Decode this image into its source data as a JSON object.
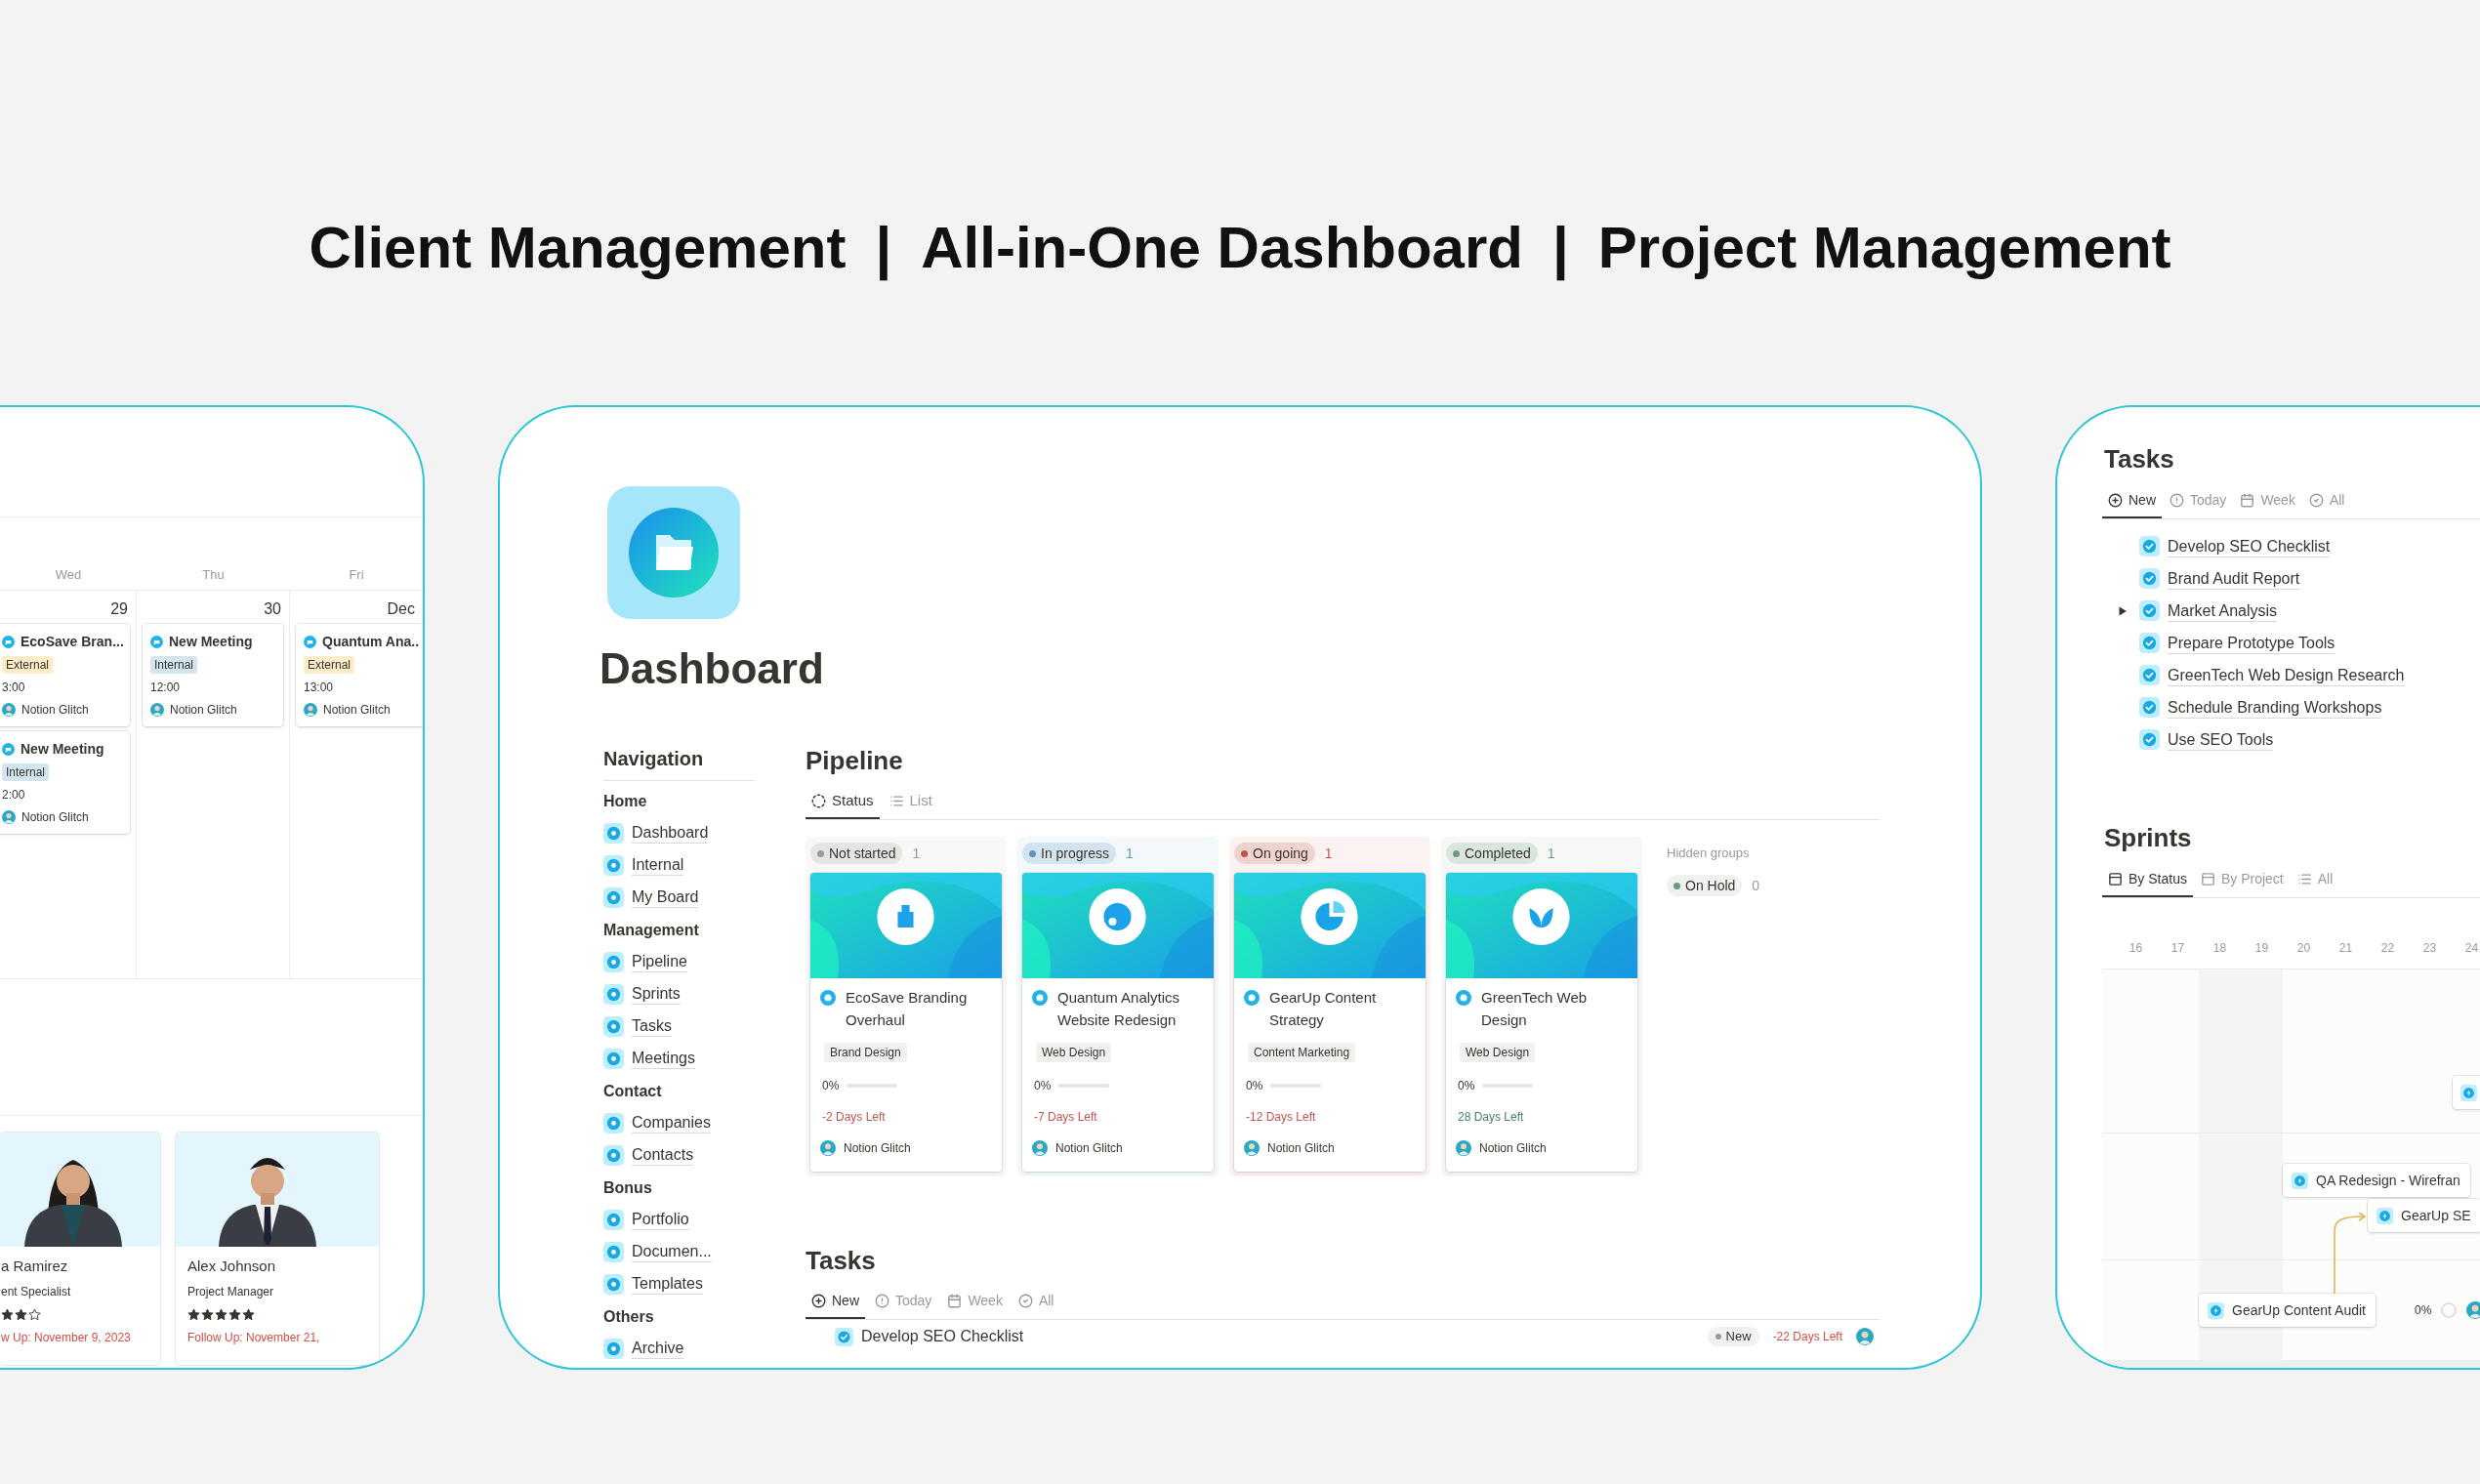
{
  "headline": [
    "Client Management",
    "|",
    "All-in-One Dashboard",
    "|",
    "Project Management"
  ],
  "calendar": {
    "days": [
      {
        "label": "Wed",
        "date": "29",
        "events": [
          {
            "title": "EcoSave Bran...",
            "tag": "External",
            "color": "#fdecc8",
            "time": "3:00",
            "owner": "Notion Glitch"
          },
          {
            "title": "New Meeting",
            "tag": "Internal",
            "color": "#d3e5ef",
            "time": "2:00",
            "owner": "Notion Glitch"
          }
        ]
      },
      {
        "label": "Thu",
        "date": "30",
        "events": [
          {
            "title": "New Meeting",
            "tag": "Internal",
            "color": "#d3e5ef",
            "time": "12:00",
            "owner": "Notion Glitch"
          }
        ]
      },
      {
        "label": "Fri",
        "date": "Dec",
        "events": [
          {
            "title": "Quantum Ana..",
            "tag": "External",
            "color": "#fdecc8",
            "time": "13:00",
            "owner": "Notion Glitch"
          }
        ]
      }
    ]
  },
  "contacts": [
    {
      "name": "a Ramirez",
      "role": "ent Specialist",
      "stars": 2,
      "follow_up": "w Up: November 9, 2023"
    },
    {
      "name": "Alex Johnson",
      "role": "Project Manager",
      "stars": 5,
      "follow_up": "Follow Up: November 21,"
    }
  ],
  "dashboard": {
    "title": "Dashboard",
    "navigation": {
      "heading": "Navigation",
      "sections": [
        {
          "label": "Home",
          "items": [
            "Dashboard",
            "Internal",
            "My Board"
          ]
        },
        {
          "label": "Management",
          "items": [
            "Pipeline",
            "Sprints",
            "Tasks",
            "Meetings"
          ]
        },
        {
          "label": "Contact",
          "items": [
            "Companies",
            "Contacts"
          ]
        },
        {
          "label": "Bonus",
          "items": [
            "Portfolio",
            "Documen...",
            "Templates"
          ]
        },
        {
          "label": "Others",
          "items": [
            "Archive"
          ]
        }
      ]
    },
    "pipeline": {
      "title": "Pipeline",
      "views": [
        {
          "label": "Status",
          "selected": true
        },
        {
          "label": "List",
          "selected": false
        }
      ],
      "groups": [
        {
          "label": "Not started",
          "count": "1",
          "color": "#9b9a97",
          "cards": [
            {
              "title": "EcoSave Branding Overhaul",
              "tag": "Brand Design",
              "progress": "0%",
              "level": 0,
              "due": "-2 Days Left",
              "overdue": true,
              "owner": "Notion Glitch"
            }
          ]
        },
        {
          "label": "In progress",
          "count": "1",
          "color": "#5b97bd",
          "cards": [
            {
              "title": "Quantum Analytics Website Redesign",
              "tag": "Web Design",
              "progress": "0%",
              "level": 0,
              "due": "-7 Days Left",
              "overdue": true,
              "owner": "Notion Glitch"
            }
          ]
        },
        {
          "label": "On going",
          "count": "1",
          "color": "#c4554d",
          "cards": [
            {
              "title": "GearUp Content Strategy",
              "tag": "Content Marketing",
              "progress": "0%",
              "level": 0,
              "due": "-12 Days Left",
              "overdue": true,
              "owner": "Notion Glitch"
            }
          ]
        },
        {
          "label": "Completed",
          "count": "1",
          "color": "#6c9b7d",
          "cards": [
            {
              "title": "GreenTech Web Design",
              "tag": "Web Design",
              "progress": "0%",
              "level": 0,
              "due": "28 Days Left",
              "overdue": false,
              "owner": "Notion Glitch"
            }
          ]
        }
      ],
      "hidden_label": "Hidden groups",
      "hidden_groups": [
        {
          "label": "On Hold",
          "count": "0",
          "color": "#6c9b7d"
        }
      ]
    },
    "tasks": {
      "title": "Tasks",
      "views": [
        {
          "label": "New",
          "selected": true
        },
        {
          "label": "Today",
          "selected": false
        },
        {
          "label": "Week",
          "selected": false
        },
        {
          "label": "All",
          "selected": false
        }
      ],
      "rows": [
        {
          "title": "Develop SEO Checklist",
          "status": "New",
          "due": "-22 Days Left"
        }
      ]
    }
  },
  "tasks_panel": {
    "title": "Tasks",
    "views": [
      {
        "label": "New",
        "selected": true
      },
      {
        "label": "Today",
        "selected": false
      },
      {
        "label": "Week",
        "selected": false
      },
      {
        "label": "All",
        "selected": false
      }
    ],
    "items": [
      {
        "title": "Develop SEO Checklist",
        "expandable": false
      },
      {
        "title": "Brand Audit Report",
        "expandable": false
      },
      {
        "title": "Market Analysis",
        "expandable": true
      },
      {
        "title": "Prepare Prototype Tools",
        "expandable": false
      },
      {
        "title": "GreenTech Web Design Research",
        "expandable": false
      },
      {
        "title": "Schedule Branding Workshops",
        "expandable": false
      },
      {
        "title": "Use SEO Tools",
        "expandable": false
      }
    ]
  },
  "sprints": {
    "title": "Sprints",
    "views": [
      {
        "label": "By Status",
        "selected": true
      },
      {
        "label": "By Project",
        "selected": false
      },
      {
        "label": "All",
        "selected": false
      }
    ],
    "days": [
      "16",
      "17",
      "18",
      "19",
      "20",
      "21",
      "22",
      "23",
      "24"
    ],
    "bars": [
      {
        "title": "QA Redesign - Wirefran"
      },
      {
        "title": "GearUp SE"
      },
      {
        "title": "GearUp Content Audit",
        "progress": "0%"
      }
    ]
  }
}
